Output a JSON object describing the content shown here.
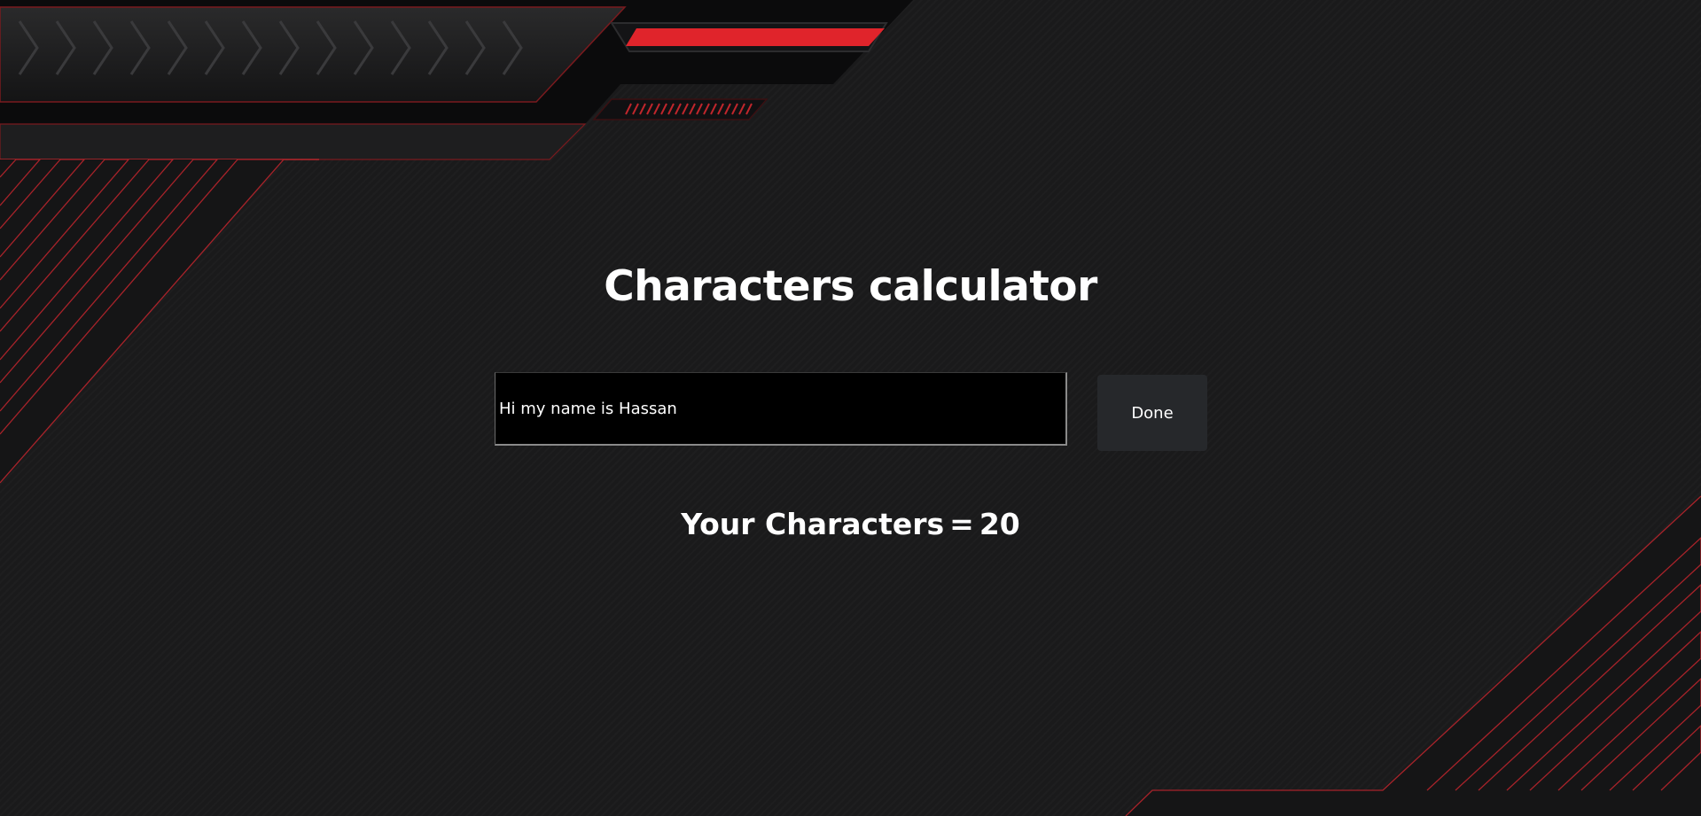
{
  "page": {
    "title": "Characters calculator"
  },
  "form": {
    "input_value": "Hi my name is Hassan",
    "submit_label": "Done"
  },
  "result": {
    "label": "Your Characters",
    "operator": "=",
    "count": "20"
  },
  "theme": {
    "background": "#1a1a1b",
    "accent_red": "#e0242b",
    "button_bg": "#26282b",
    "text": "#ffffff"
  }
}
